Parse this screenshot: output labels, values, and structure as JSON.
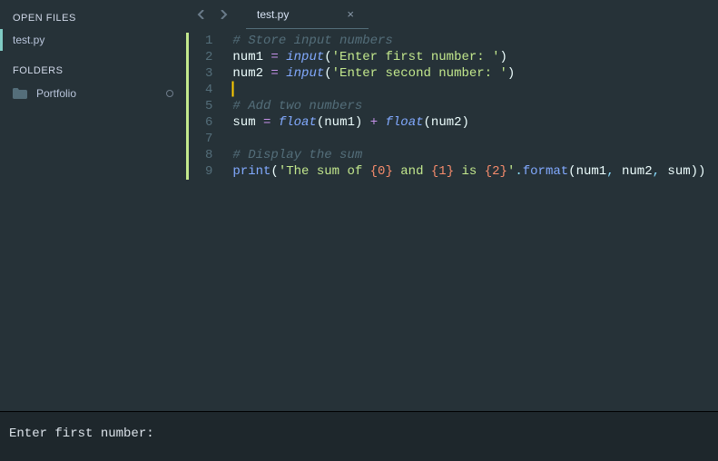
{
  "sidebar": {
    "open_files_heading": "OPEN FILES",
    "open_files": [
      {
        "label": "test.py",
        "active": true
      }
    ],
    "folders_heading": "FOLDERS",
    "folders": [
      {
        "label": "Portfolio"
      }
    ]
  },
  "tabs": {
    "items": [
      {
        "label": "test.py",
        "active": true
      }
    ]
  },
  "editor": {
    "filename": "test.py",
    "cursor_line": 4,
    "lines": [
      {
        "n": 1,
        "tokens": [
          {
            "t": "# Store input numbers",
            "c": "comment"
          }
        ]
      },
      {
        "n": 2,
        "tokens": [
          {
            "t": "num1",
            "c": "var"
          },
          {
            "t": " ",
            "c": ""
          },
          {
            "t": "=",
            "c": "op"
          },
          {
            "t": " ",
            "c": ""
          },
          {
            "t": "input",
            "c": "builtin"
          },
          {
            "t": "(",
            "c": "paren"
          },
          {
            "t": "'Enter first number: '",
            "c": "string"
          },
          {
            "t": ")",
            "c": "paren"
          }
        ]
      },
      {
        "n": 3,
        "tokens": [
          {
            "t": "num2",
            "c": "var"
          },
          {
            "t": " ",
            "c": ""
          },
          {
            "t": "=",
            "c": "op"
          },
          {
            "t": " ",
            "c": ""
          },
          {
            "t": "input",
            "c": "builtin"
          },
          {
            "t": "(",
            "c": "paren"
          },
          {
            "t": "'Enter second number: '",
            "c": "string"
          },
          {
            "t": ")",
            "c": "paren"
          }
        ]
      },
      {
        "n": 4,
        "tokens": []
      },
      {
        "n": 5,
        "tokens": [
          {
            "t": "# Add two numbers",
            "c": "comment"
          }
        ]
      },
      {
        "n": 6,
        "tokens": [
          {
            "t": "sum",
            "c": "var"
          },
          {
            "t": " ",
            "c": ""
          },
          {
            "t": "=",
            "c": "op"
          },
          {
            "t": " ",
            "c": ""
          },
          {
            "t": "float",
            "c": "builtin"
          },
          {
            "t": "(",
            "c": "paren"
          },
          {
            "t": "num1",
            "c": "var"
          },
          {
            "t": ")",
            "c": "paren"
          },
          {
            "t": " ",
            "c": ""
          },
          {
            "t": "+",
            "c": "op"
          },
          {
            "t": " ",
            "c": ""
          },
          {
            "t": "float",
            "c": "builtin"
          },
          {
            "t": "(",
            "c": "paren"
          },
          {
            "t": "num2",
            "c": "var"
          },
          {
            "t": ")",
            "c": "paren"
          }
        ]
      },
      {
        "n": 7,
        "tokens": []
      },
      {
        "n": 8,
        "tokens": [
          {
            "t": "# Display the sum",
            "c": "comment"
          }
        ]
      },
      {
        "n": 9,
        "tokens": [
          {
            "t": "print",
            "c": "func"
          },
          {
            "t": "(",
            "c": "paren"
          },
          {
            "t": "'The sum of ",
            "c": "string"
          },
          {
            "t": "{0}",
            "c": "fmt"
          },
          {
            "t": " and ",
            "c": "string"
          },
          {
            "t": "{1}",
            "c": "fmt"
          },
          {
            "t": " is ",
            "c": "string"
          },
          {
            "t": "{2}",
            "c": "fmt"
          },
          {
            "t": "'",
            "c": "string"
          },
          {
            "t": ".",
            "c": "punct"
          },
          {
            "t": "format",
            "c": "func"
          },
          {
            "t": "(",
            "c": "paren"
          },
          {
            "t": "num1",
            "c": "var"
          },
          {
            "t": ",",
            "c": "punct"
          },
          {
            "t": " ",
            "c": ""
          },
          {
            "t": "num2",
            "c": "var"
          },
          {
            "t": ",",
            "c": "punct"
          },
          {
            "t": " ",
            "c": ""
          },
          {
            "t": "sum",
            "c": "var"
          },
          {
            "t": ")",
            "c": "paren"
          },
          {
            "t": ")",
            "c": "paren"
          }
        ]
      }
    ]
  },
  "console": {
    "output": "Enter first number:"
  }
}
